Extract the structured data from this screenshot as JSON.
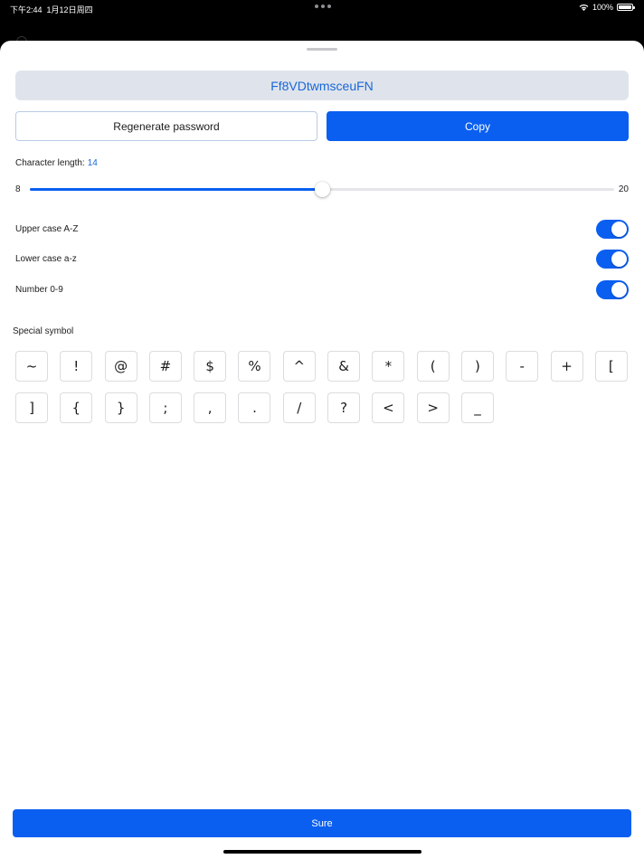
{
  "status_bar": {
    "time": "下午2:44",
    "date": "1月12日周四",
    "battery": "100%"
  },
  "password": {
    "value": "Ff8VDtwmsceuFN"
  },
  "actions": {
    "regenerate_label": "Regenerate password",
    "copy_label": "Copy"
  },
  "length": {
    "label": "Character length:",
    "value": "14",
    "min": "8",
    "max": "20",
    "level": 0.5
  },
  "options": [
    {
      "label": "Upper case A-Z",
      "enabled": true
    },
    {
      "label": "Lower case a-z",
      "enabled": true
    },
    {
      "label": "Number 0-9",
      "enabled": true
    }
  ],
  "special": {
    "label": "Special symbol",
    "symbols": [
      "~",
      "!",
      "@",
      "#",
      "$",
      "%",
      "^",
      "&",
      "*",
      "(",
      ")",
      "-",
      "+",
      "[",
      "]",
      "{",
      "}",
      ";",
      ",",
      ".",
      "/",
      "?",
      "<",
      ">",
      "_"
    ]
  },
  "footer": {
    "confirm_label": "Sure"
  },
  "colors": {
    "accent": "#0a5ff0",
    "password_text": "#1a66d6",
    "password_bg": "#dfe4ec"
  }
}
